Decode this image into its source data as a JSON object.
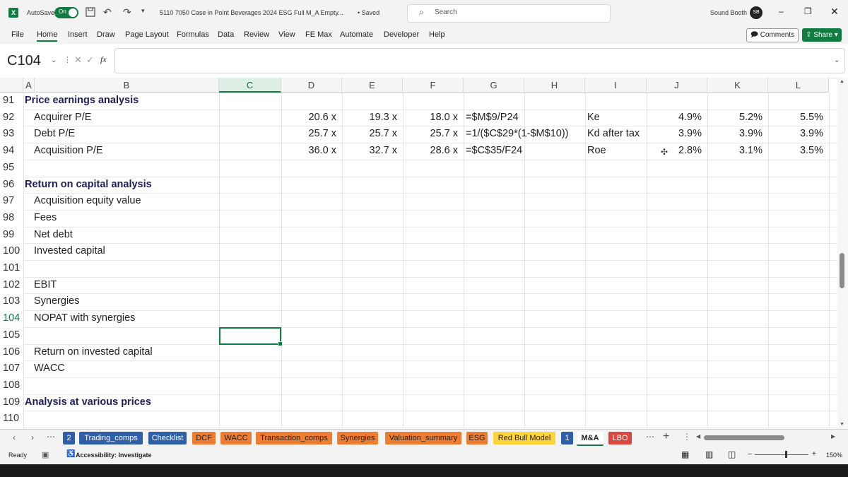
{
  "titlebar": {
    "autosave_label": "AutoSave",
    "autosave_state": "On",
    "filename": "5110 7050 Case in Point Beverages 2024 ESG Full M_A Empty...",
    "saved": "• Saved",
    "search_placeholder": "Search",
    "user_name": "Sound Booth",
    "user_initials": "SB"
  },
  "menu": {
    "items": [
      "File",
      "Home",
      "Insert",
      "Draw",
      "Page Layout",
      "Formulas",
      "Data",
      "Review",
      "View",
      "FE Max",
      "Automate",
      "Developer",
      "Help"
    ],
    "comments": "Comments",
    "share": "Share"
  },
  "formula_bar": {
    "name_box": "C104",
    "fx": "fx",
    "value": ""
  },
  "columns": [
    "A",
    "B",
    "C",
    "D",
    "E",
    "F",
    "G",
    "H",
    "I",
    "J",
    "K",
    "L"
  ],
  "selected_column": "C",
  "rows": [
    {
      "num": "91",
      "a": "Price earnings analysis",
      "a_bold": true,
      "b": ""
    },
    {
      "num": "92",
      "a": "",
      "b": "Acquirer P/E",
      "d": "20.6 x",
      "e": "19.3 x",
      "f": "18.0 x",
      "g": "=$M$9/P24",
      "i": "Ke",
      "j": "4.9%",
      "k": "5.2%",
      "l": "5.5%"
    },
    {
      "num": "93",
      "a": "",
      "b": "Debt P/E",
      "d": "25.7 x",
      "e": "25.7 x",
      "f": "25.7 x",
      "g": "=1/($C$29*(1-$M$10))",
      "i": "Kd after tax",
      "j": "3.9%",
      "k": "3.9%",
      "l": "3.9%"
    },
    {
      "num": "94",
      "a": "",
      "b": "Acquisition P/E",
      "d": "36.0 x",
      "e": "32.7 x",
      "f": "28.6 x",
      "g": "=$C$35/F24",
      "i": "Roe",
      "j": "2.8%",
      "k": "3.1%",
      "l": "3.5%"
    },
    {
      "num": "95",
      "a": "",
      "b": ""
    },
    {
      "num": "96",
      "a": "Return on capital analysis",
      "a_bold": true,
      "b": ""
    },
    {
      "num": "97",
      "a": "",
      "b": "Acquisition equity value"
    },
    {
      "num": "98",
      "a": "",
      "b": "Fees"
    },
    {
      "num": "99",
      "a": "",
      "b": "Net debt"
    },
    {
      "num": "100",
      "a": "",
      "b": "Invested capital"
    },
    {
      "num": "101",
      "a": "",
      "b": ""
    },
    {
      "num": "102",
      "a": "",
      "b": "EBIT"
    },
    {
      "num": "103",
      "a": "",
      "b": "Synergies"
    },
    {
      "num": "104",
      "a": "",
      "b": "NOPAT with synergies"
    },
    {
      "num": "105",
      "a": "",
      "b": ""
    },
    {
      "num": "106",
      "a": "",
      "b": "Return on invested capital"
    },
    {
      "num": "107",
      "a": "",
      "b": "WACC"
    },
    {
      "num": "108",
      "a": "",
      "b": ""
    },
    {
      "num": "109",
      "a": "Analysis at various prices",
      "a_bold": true,
      "b": ""
    },
    {
      "num": "110",
      "a": "",
      "b": ""
    }
  ],
  "sheet_tabs": [
    {
      "label": "2",
      "bg": "#2e5fa8",
      "fg": "#ffffff"
    },
    {
      "label": "Trading_comps",
      "bg": "#2e5fa8",
      "fg": "#ffffff"
    },
    {
      "label": "Checklist",
      "bg": "#2e5fa8",
      "fg": "#ffffff"
    },
    {
      "label": "DCF",
      "bg": "#ed7d31",
      "fg": "#222222"
    },
    {
      "label": "WACC",
      "bg": "#ed7d31",
      "fg": "#222222"
    },
    {
      "label": "Transaction_comps",
      "bg": "#ed7d31",
      "fg": "#222222"
    },
    {
      "label": "Synergies",
      "bg": "#ed7d31",
      "fg": "#222222"
    },
    {
      "label": "Valuation_summary",
      "bg": "#ed7d31",
      "fg": "#222222"
    },
    {
      "label": "ESG",
      "bg": "#ed7d31",
      "fg": "#222222"
    },
    {
      "label": "Red Bull Model",
      "bg": "#ffd43b",
      "fg": "#222222"
    },
    {
      "label": "1",
      "bg": "#2e5fa8",
      "fg": "#ffffff"
    },
    {
      "label": "M&A",
      "bg": "#ffffff",
      "fg": "#222222"
    },
    {
      "label": "LBO",
      "bg": "#d9473f",
      "fg": "#ffffff"
    }
  ],
  "status": {
    "ready": "Ready",
    "accessibility": "Accessibility: Investigate",
    "zoom": "150%"
  },
  "colors": {
    "accent": "#107c41",
    "header_text": "#1e1e5a"
  }
}
